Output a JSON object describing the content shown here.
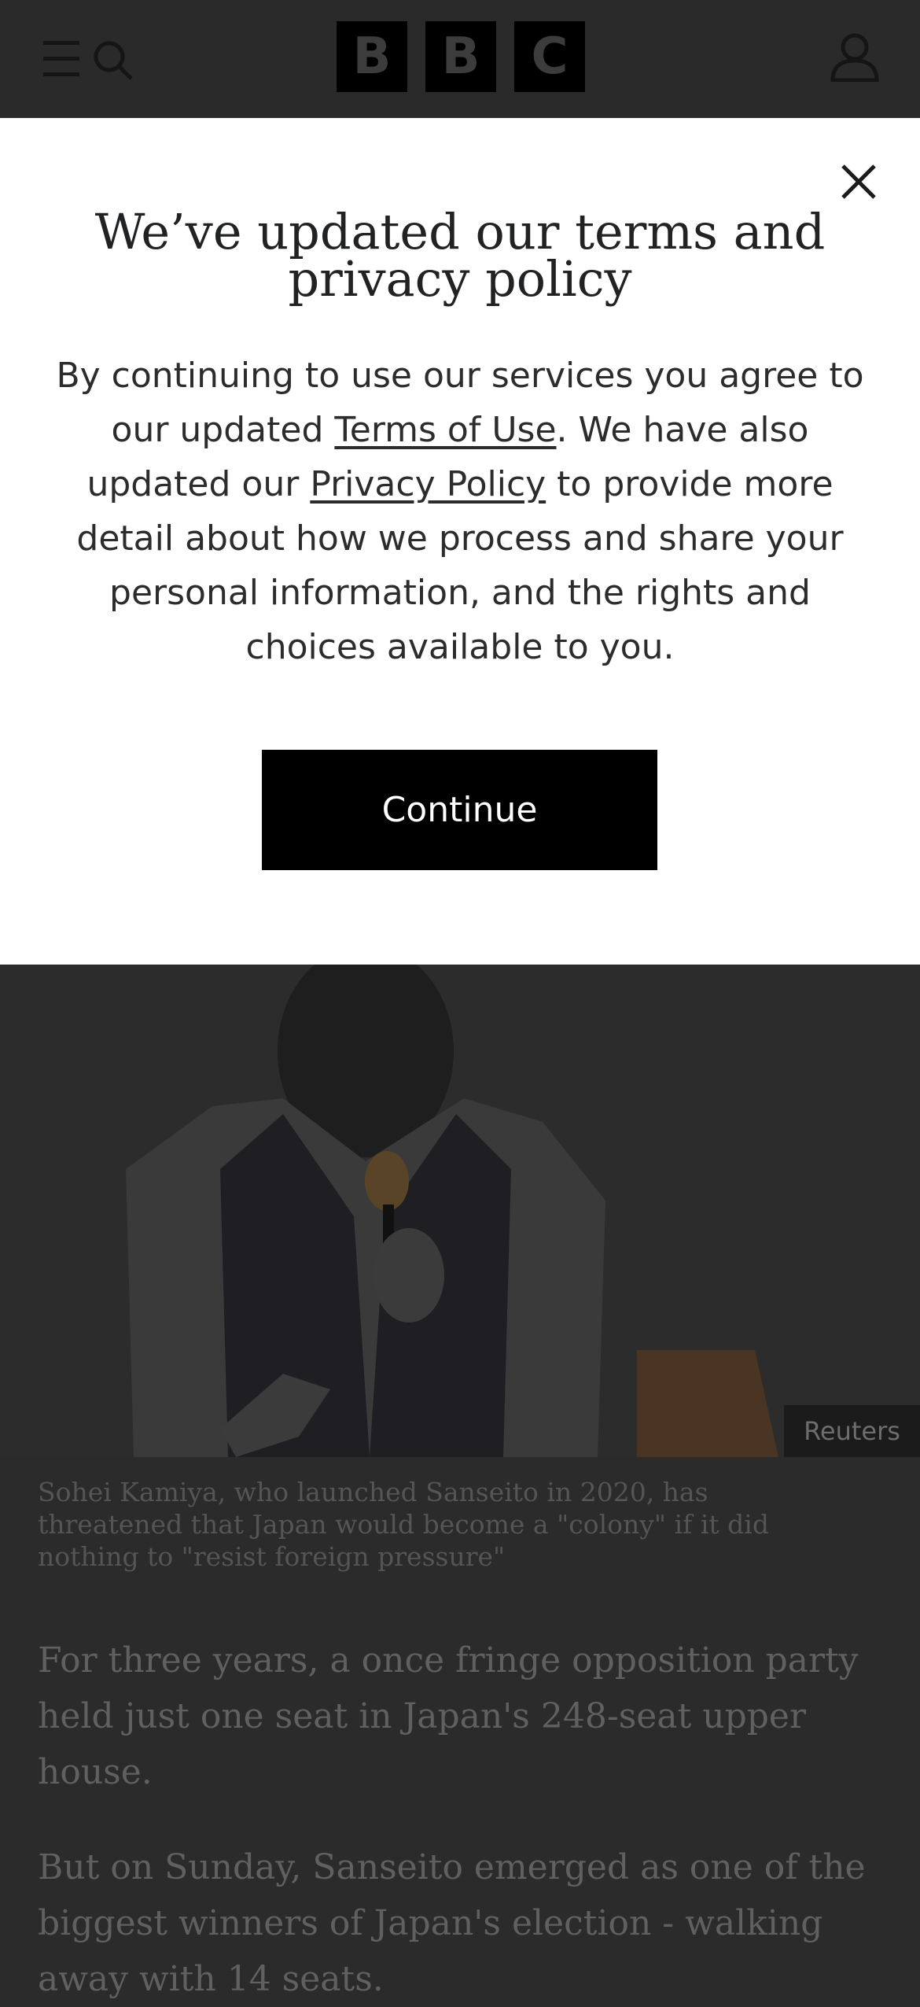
{
  "header": {
    "logo_letters": [
      "B",
      "B",
      "C"
    ],
    "menu_icon": "menu-search-icon",
    "account_icon": "account-icon"
  },
  "modal": {
    "title": "We’ve updated our terms and privacy policy",
    "body_part1": "By continuing to use our services you agree to our updated ",
    "terms_link": "Terms of Use",
    "body_part2": ". We have also updated our ",
    "privacy_link": "Privacy Policy",
    "body_part3": " to provide more detail about how we process and share your personal information, and the rights and choices available to you.",
    "continue_label": "Continue",
    "close_icon": "close-icon"
  },
  "article": {
    "image_credit": "Reuters",
    "caption": "Sohei Kamiya, who launched Sanseito in 2020, has threatened that Japan would become a \"colony\" if it did nothing to \"resist foreign pressure\"",
    "paragraphs": [
      "For three years, a once fringe opposition party held just one seat in Japan's 248-seat upper house.",
      "But on Sunday, Sanseito emerged as one of the biggest winners of Japan's election - walking away with 14 seats."
    ]
  },
  "colors": {
    "overlay": "#2b2b2b",
    "modal_bg": "#ffffff",
    "button_bg": "#000000",
    "button_text": "#ffffff"
  }
}
